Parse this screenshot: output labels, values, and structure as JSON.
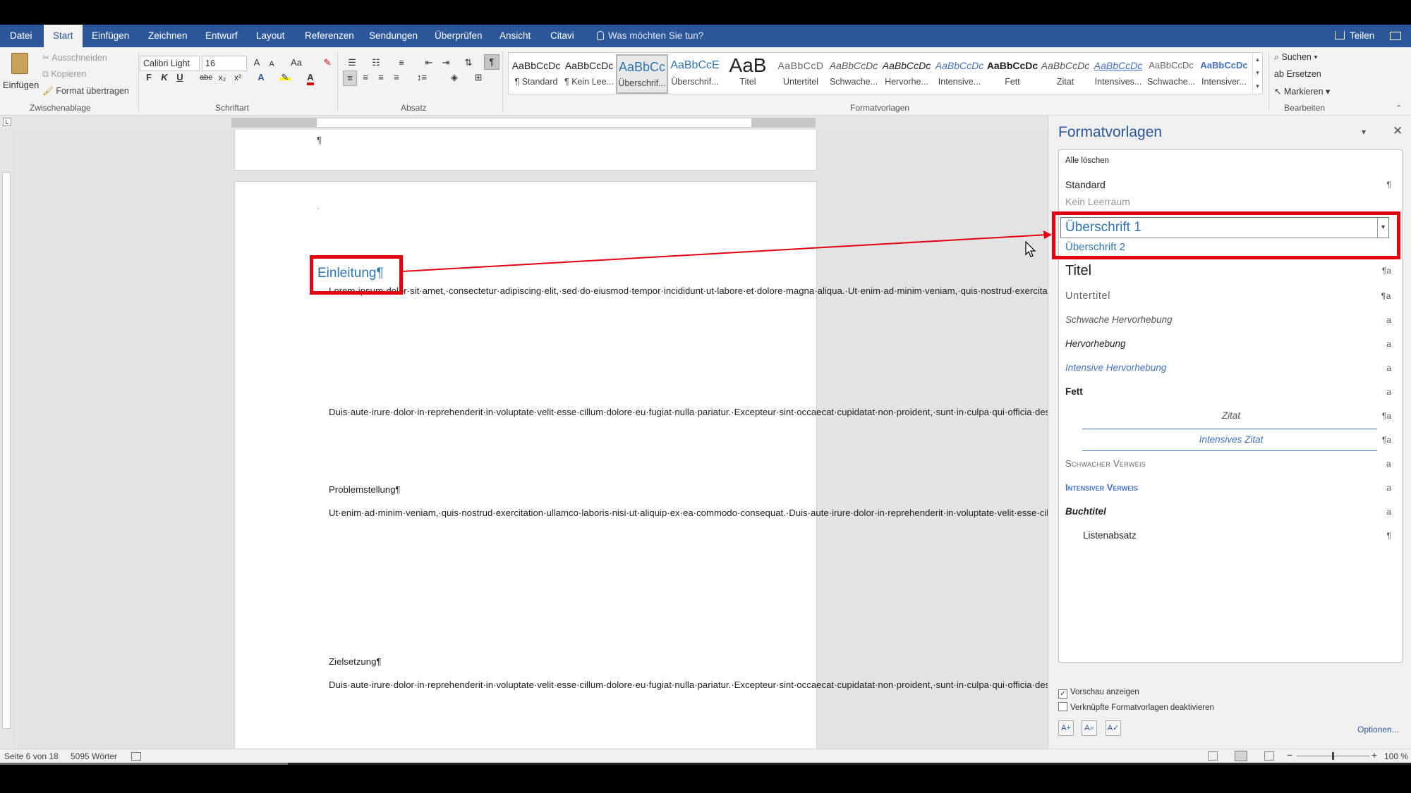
{
  "tabs": [
    "Datei",
    "Start",
    "Einfügen",
    "Zeichnen",
    "Entwurf",
    "Layout",
    "Referenzen",
    "Sendungen",
    "Überprüfen",
    "Ansicht",
    "Citavi"
  ],
  "active_tab": "Start",
  "tell_me": "Was möchten Sie tun?",
  "share": "Teilen",
  "clipboard": {
    "paste": "Einfügen",
    "cut": "Ausschneiden",
    "copy": "Kopieren",
    "format_painter": "Format übertragen",
    "label": "Zwischenablage"
  },
  "font": {
    "name": "Calibri Light",
    "size": "16",
    "label": "Schriftart",
    "bold": "F",
    "italic": "K",
    "underline": "U",
    "strike": "abc",
    "sub": "x₂",
    "sup": "x²",
    "grow": "A",
    "shrink": "A",
    "case": "Aa"
  },
  "paragraph": {
    "label": "Absatz"
  },
  "styles_gallery": {
    "label": "Formatvorlagen",
    "items": [
      {
        "preview": "AaBbCcDc",
        "name": "¶ Standard"
      },
      {
        "preview": "AaBbCcDc",
        "name": "¶ Kein Lee..."
      },
      {
        "preview": "AaBbCc",
        "name": "Überschrif..."
      },
      {
        "preview": "AaBbCcE",
        "name": "Überschrif..."
      },
      {
        "preview": "AaB",
        "name": "Titel"
      },
      {
        "preview": "AaBbCcD",
        "name": "Untertitel"
      },
      {
        "preview": "AaBbCcDc",
        "name": "Schwache..."
      },
      {
        "preview": "AaBbCcDc",
        "name": "Hervorhe..."
      },
      {
        "preview": "AaBbCcDc",
        "name": "Intensive..."
      },
      {
        "preview": "AaBbCcDc",
        "name": "Fett"
      },
      {
        "preview": "AaBbCcDc",
        "name": "Zitat"
      },
      {
        "preview": "AaBbCcDc",
        "name": "Intensives..."
      },
      {
        "preview": "AaBbCcDc",
        "name": "Schwache..."
      },
      {
        "preview": "AaBbCcDc",
        "name": "Intensiver..."
      }
    ]
  },
  "editing": {
    "label": "Bearbeiten",
    "find": "Suchen",
    "replace": "Ersetzen",
    "select": "Markieren"
  },
  "document": {
    "prev_page_mark": "¶",
    "first_line_mark": "·",
    "heading": "Einleitung¶",
    "p1": "Lorem·ipsum·dolor·sit·amet,·consectetur·adipiscing·elit,·sed·do·eiusmod·tempor·incididunt·ut·labore·et·dolore·magna·aliqua.·Ut·enim·ad·minim·veniam,·quis·nostrud·exercitation·ullamco·laboris·nisi·ut·aliquip·ex·ea·commodo·consequat.·Duis·aute·irure·dolor·in·reprehenderit·in·voluptate·velit·esse·cillum·dolore·eu·fugiat·nulla·pariatur.·Excepteur·sint·occaecat·cupidatat·non·proident,·sunt·in·culpa·qui·officia·deserunt·mollit·anim·id·est·laborum.·Lorem·ipsum·dolor·sit·amet,·consectetur·adipiscing·elit,·sed·do·eiusmod·tempor·incididunt·ut·labore·et·dolore·magna·aliqua.·Ut·enim·ad·minim·veniam,·quis·nostrud·exercitation·ullamco·laboris·nisi·ut·aliquip·ex·ea·commodo·consequat.·¶",
    "p2": "Duis·aute·irure·dolor·in·reprehenderit·in·voluptate·velit·esse·cillum·dolore·eu·fugiat·nulla·pariatur.·Excepteur·sint·occaecat·cupidatat·non·proident,·sunt·in·culpa·qui·officia·deserunt·mollit·anim·id·est·laborum.·Lorem·ipsum·dolor·sit·amet,·consectetur·adipiscing·elit,·sed·do·eiusmod·tempor·incididunt·ut·labore·et·dolore·magna·aliqua.·Ut·enim·ad·minim·veniam,·quis·nostrud·exercitation·ullamco·laboris·nisi·ut·aliquip·ex·ea·commodo·consequat.·¶",
    "h2": "Problemstellung¶",
    "p3": "Ut·enim·ad·minim·veniam,·quis·nostrud·exercitation·ullamco·laboris·nisi·ut·aliquip·ex·ea·commodo·consequat.·Duis·aute·irure·dolor·in·reprehenderit·in·voluptate·velit·esse·cillum·dolore·eu·fugiat·nulla·pariatur.·Excepteur·sint·occaecat·cupidatat·non·proident,·sunt·in·culpa·qui·officia·deserunt·mollit·anim·id·est·laborum.·Lorem·ipsum·dolor·sit·amet,·consectetur·adipiscing·elit,·sed·do·eiusmod·tempor·incididunt·ut·labore·et·dolore·magna·aliqua.·Ut·enim·ad·minim·veniam,·quis·nostrud·exercitation·ullamco·laboris·nisi·ut·aliquip·ex·ea·commodo·consequat.·Duis·aute·irure·dolor·in·reprehenderit·in·voluptate·velit·esse·cillum·dolore·eu·fugiat·nulla·pariatur.·Excepteur·sint·occaecat·cupidatat·non·proident,·sunt·in·culpa·qui·officia·deserunt·mollit·anim·id·est·laborum.·Lorem·ipsum·dolor·sit·amet,·consectetur·adipiscing·elit,·sed·do·eiusmod·tempor·incididunt·ut·labore·et·dolore·magna·aliqua.·¶",
    "h3": "Zielsetzung¶",
    "p4": "Duis·aute·irure·dolor·in·reprehenderit·in·voluptate·velit·esse·cillum·dolore·eu·fugiat·nulla·pariatur.·Excepteur·sint·occaecat·cupidatat·non·proident,·sunt·in·culpa·qui·officia·deserunt·mollit·anim·id·est·laborum.·Lorem·ipsum·dolor·sit·amet,·consectetur·adipiscing·elit,·sed·do·eiusmod·tempor·incididunt·ut·labore·et·dolore·magna·aliqua.·Ut·enim·ad·minim·veniam,·quis·nostrud·exercitation·ullamco·laboris·nisi·ut·aliquip·ex·ea·commodo·consequat.·Duis·aute·irure·dolor·in·reprehenderit·in·"
  },
  "styles_pane": {
    "title": "Formatvorlagen",
    "clear_all": "Alle löschen",
    "standard": "Standard",
    "no_spacing": "Kein Leerraum",
    "heading1_selected": "Überschrift 1",
    "heading2": "Überschrift 2",
    "titel": "Titel",
    "untertitel": "Untertitel",
    "subtle_emphasis": "Schwache Hervorhebung",
    "emphasis": "Hervorhebung",
    "intense_emphasis": "Intensive Hervorhebung",
    "strong": "Fett",
    "quote": "Zitat",
    "intense_quote": "Intensives Zitat",
    "subtle_ref": "Schwacher Verweis",
    "intense_ref": "Intensiver Verweis",
    "book_title": "Buchtitel",
    "list_paragraph": "Listenabsatz",
    "show_preview": "Vorschau anzeigen",
    "disable_linked": "Verknüpfte Formatvorlagen deaktivieren",
    "options": "Optionen..."
  },
  "status": {
    "page": "Seite 6 von 18",
    "words": "5095 Wörter",
    "zoom": "100 %"
  },
  "colors": {
    "word_blue": "#2b579a",
    "annotation_red": "#e3000f",
    "heading_blue": "#2e74b5"
  }
}
